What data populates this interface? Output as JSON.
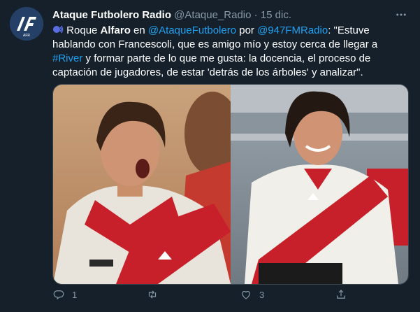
{
  "tweet": {
    "author_name": "Ataque Futbolero Radio",
    "author_handle": "@Ataque_Radio",
    "separator": "·",
    "date": "15 dic.",
    "avatar_text": "AFR",
    "text": {
      "t1": "Roque ",
      "t2": "Alfaro",
      "t3": " en ",
      "mention1": "@AtaqueFutbolero",
      "t4": " por ",
      "mention2": "@947FMRadio",
      "t5": ": \"Estuve hablando con Francescoli, que es amigo mío y estoy cerca de llegar a ",
      "hashtag": "#River",
      "t6": " y formar parte de lo que me gusta: la docencia, el proceso de captación de jugadores, de estar 'detrás de los árboles' y analizar\"."
    },
    "actions": {
      "reply_count": "1",
      "retweet_count": "",
      "like_count": "3"
    },
    "colors": {
      "background": "#15202b",
      "link": "#1da1f2",
      "muted": "#8899a6"
    },
    "icons": [
      "speaker-emoji-icon",
      "more-icon",
      "reply-icon",
      "retweet-icon",
      "like-icon",
      "share-icon"
    ]
  }
}
